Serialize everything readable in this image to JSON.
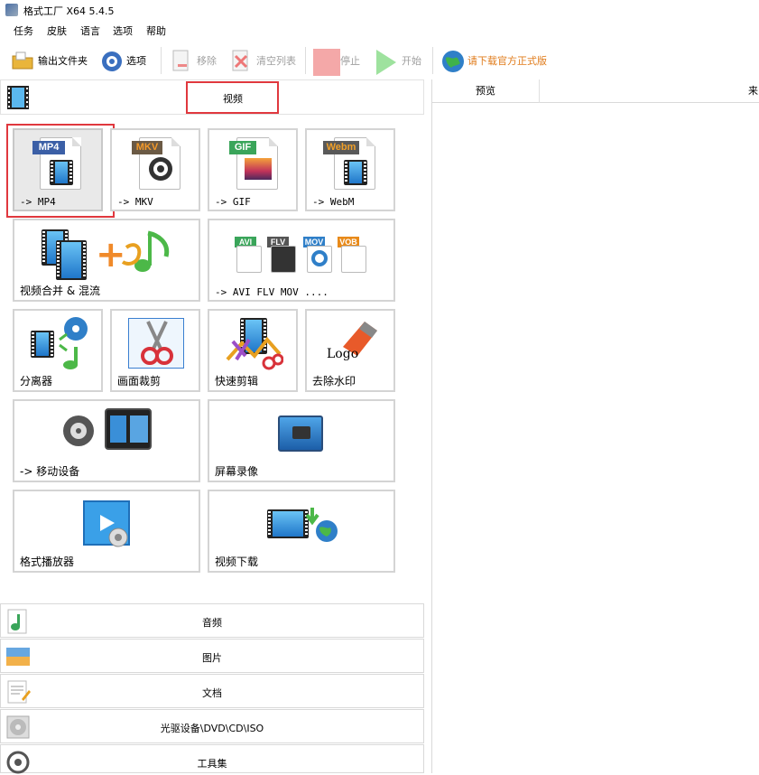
{
  "window": {
    "title": "格式工厂 X64 5.4.5"
  },
  "menu": {
    "items": [
      "任务",
      "皮肤",
      "语言",
      "选项",
      "帮助"
    ]
  },
  "toolbar": {
    "output_folder": "输出文件夹",
    "options": "选项",
    "remove": "移除",
    "clear_list": "清空列表",
    "stop": "停止",
    "start": "开始",
    "download_official": "请下载官方正式版"
  },
  "sections": {
    "video": "视频",
    "audio": "音频",
    "picture": "图片",
    "document": "文档",
    "optical": "光驱设备\\DVD\\CD\\ISO",
    "tools": "工具集"
  },
  "tiles": {
    "mp4": "-> MP4",
    "mkv": "-> MKV",
    "gif": "-> GIF",
    "webm": "-> WebM",
    "merge": "视频合并 & 混流",
    "multi": "-> AVI FLV MOV ....",
    "splitter": "分离器",
    "crop": "画面裁剪",
    "quick_clip": "快速剪辑",
    "remove_watermark": "去除水印",
    "mobile": "-> 移动设备",
    "screen_record": "屏幕录像",
    "player": "格式播放器",
    "video_download": "视频下载"
  },
  "icon_tags": {
    "mp4": "MP4",
    "mkv": "MKV",
    "gif": "GIF",
    "webm": "Webm",
    "avi": "AVI",
    "flv": "FLV",
    "mov": "MOV",
    "vob": "VOB",
    "logo": "Logo"
  },
  "task_list": {
    "col_preview": "预览",
    "col_source": "来"
  },
  "colors": {
    "highlight": "#e0383e",
    "mp4_tag": "#3b5fa6",
    "mkv_tag": "#e07b20",
    "gif_tag": "#3aa55a",
    "webm_tag": "#e88a1a"
  }
}
